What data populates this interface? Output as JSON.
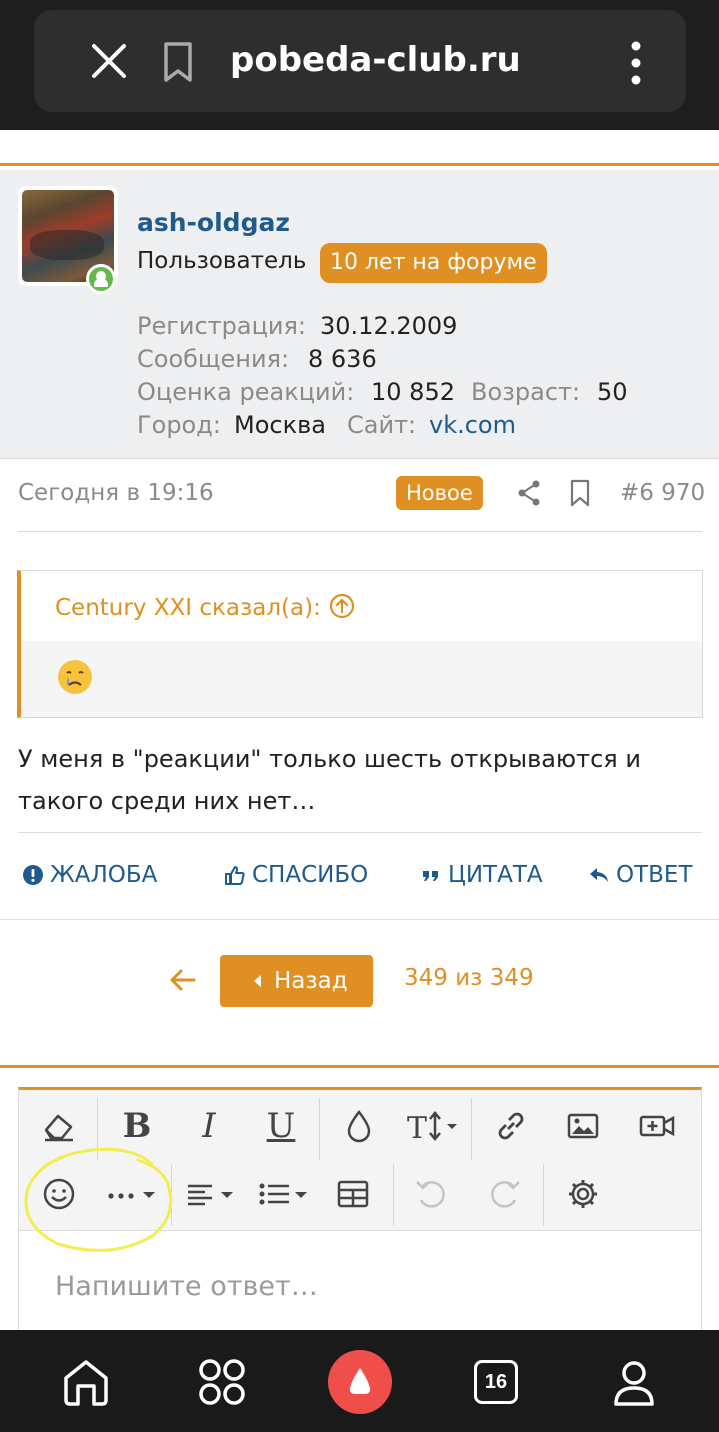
{
  "browser": {
    "url": "pobeda-club.ru",
    "icons": [
      "close-icon",
      "bookmark-icon",
      "more-vertical-icon"
    ]
  },
  "author": {
    "username": "ash-oldgaz",
    "role": "Пользователь",
    "badge": "10 лет на форуме",
    "online": true,
    "stats": {
      "registration_label": "Регистрация:",
      "registration_value": "30.12.2009",
      "messages_label": "Сообщения:",
      "messages_value": "8 636",
      "reactions_label": "Оценка реакций:",
      "reactions_value": "10 852",
      "age_label": "Возраст:",
      "age_value": "50",
      "city_label": "Город:",
      "city_value": "Москва",
      "site_label": "Сайт:",
      "site_value": "vk.com"
    }
  },
  "post": {
    "time": "Сегодня в 19:16",
    "new_badge": "Новое",
    "number": "#6 970",
    "quote": {
      "author": "Century XXI сказал(а):",
      "emoji": "crying-face-emoji"
    },
    "text": "У меня в \"реакции\" только шесть открываются и такого среди них нет…",
    "actions": {
      "report": "ЖАЛОБА",
      "thanks": "СПАСИБО",
      "quote": "ЦИТАТА",
      "reply": "ОТВЕТ"
    }
  },
  "pagination": {
    "back": "Назад",
    "count": "349 из 349"
  },
  "editor": {
    "placeholder": "Напишите ответ…",
    "toolbar": [
      "eraser-icon",
      "bold-icon",
      "italic-icon",
      "underline-icon",
      "color-drop-icon",
      "text-size-icon",
      "link-icon",
      "image-icon",
      "video-icon",
      "smiley-icon",
      "more-icon",
      "align-icon",
      "list-icon",
      "table-icon",
      "undo-icon",
      "redo-icon",
      "settings-icon"
    ]
  },
  "bottom_nav": {
    "tabs_count": "16"
  },
  "colors": {
    "accent": "#e08f22",
    "link": "#1f5a8a",
    "online": "#63b94a",
    "assistant": "#f04e4a"
  }
}
